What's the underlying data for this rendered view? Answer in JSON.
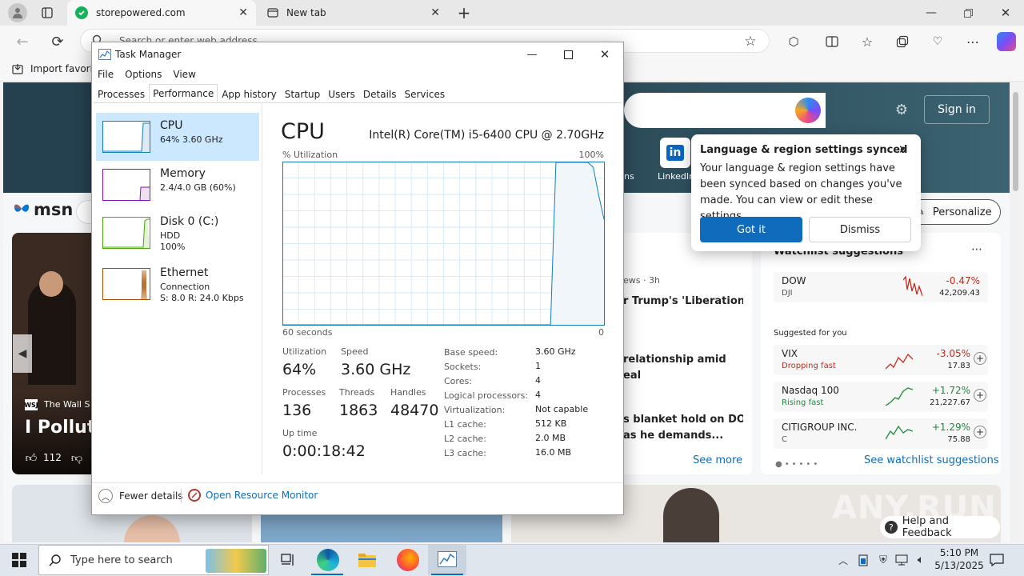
{
  "browser": {
    "tabs": [
      {
        "title": "storepowered.com",
        "active": true
      },
      {
        "title": "New tab",
        "active": false
      }
    ],
    "address_placeholder": "Search or enter web address",
    "favorites_import": "Import favorites"
  },
  "msn": {
    "logo_text": "msn",
    "sign_in": "Sign in",
    "shortcut_linkedin": "LinkedIn",
    "shortcut_partial": "ns",
    "personalize": "Personalize",
    "hero_source": "The Wall Street Journal",
    "hero_source_badge": "WSJ",
    "hero_headline": "I Pollute",
    "likes": "112",
    "news_time": "ews · 3h",
    "news1": "r Trump's 'Liberation",
    "news2a": "relationship amid",
    "news2b": "eal",
    "news3a": "s blanket hold on DOJ",
    "news3b": "as he demands...",
    "see_more": "See more",
    "watchlist_title": "Watchlist suggestions",
    "suggested_label": "Suggested for you",
    "see_watchlist": "See watchlist suggestions",
    "help_feedback": "Help and Feedback",
    "stocks": [
      {
        "name": "DOW",
        "sub": "DJI",
        "change": "-0.47%",
        "price": "42,209.43",
        "color": "#c42b1c"
      },
      {
        "name": "VIX",
        "sub": "Dropping fast",
        "change": "-3.05%",
        "price": "17.83",
        "color": "#c42b1c"
      },
      {
        "name": "Nasdaq 100",
        "sub": "Rising fast",
        "change": "+1.72%",
        "price": "21,227.67",
        "color": "#1b8a3a"
      },
      {
        "name": "CITIGROUP INC.",
        "sub": "C",
        "change": "+1.29%",
        "price": "75.88",
        "color": "#1b8a3a"
      }
    ]
  },
  "notification": {
    "title": "Language & region settings synced",
    "body": "Your language & region settings have been synced based on changes you've made. You can view or edit these settings.",
    "got_it": "Got it",
    "dismiss": "Dismiss"
  },
  "taskmanager": {
    "title": "Task Manager",
    "menu": [
      "File",
      "Options",
      "View"
    ],
    "tabs": [
      "Processes",
      "Performance",
      "App history",
      "Startup",
      "Users",
      "Details",
      "Services"
    ],
    "selected_tab": "Performance",
    "sidebar": [
      {
        "name": "CPU",
        "s1": "64%  3.60 GHz",
        "s2": "",
        "color": "#117dbb"
      },
      {
        "name": "Memory",
        "s1": "2.4/4.0 GB (60%)",
        "s2": "",
        "color": "#8b12ae"
      },
      {
        "name": "Disk 0 (C:)",
        "s1": "HDD",
        "s2": "100%",
        "color": "#4da60c"
      },
      {
        "name": "Ethernet",
        "s1": "Connection",
        "s2": "S: 8.0  R: 24.0 Kbps",
        "color": "#a74f01"
      }
    ],
    "cpu": {
      "heading": "CPU",
      "model": "Intel(R) Core(TM) i5-6400 CPU @ 2.70GHz",
      "graph_label": "% Utilization",
      "graph_max": "100%",
      "graph_time": "60 seconds",
      "graph_min": "0",
      "utilization_label": "Utilization",
      "utilization": "64%",
      "speed_label": "Speed",
      "speed": "3.60 GHz",
      "processes_label": "Processes",
      "processes": "136",
      "threads_label": "Threads",
      "threads": "1863",
      "handles_label": "Handles",
      "handles": "48470",
      "uptime_label": "Up time",
      "uptime": "0:00:18:42",
      "specs": [
        {
          "k": "Base speed:",
          "v": "3.60 GHz"
        },
        {
          "k": "Sockets:",
          "v": "1"
        },
        {
          "k": "Cores:",
          "v": "4"
        },
        {
          "k": "Logical processors:",
          "v": "4"
        },
        {
          "k": "Virtualization:",
          "v": "Not capable"
        },
        {
          "k": "L1 cache:",
          "v": "512 KB"
        },
        {
          "k": "L2 cache:",
          "v": "2.0 MB"
        },
        {
          "k": "L3 cache:",
          "v": "16.0 MB"
        }
      ],
      "history": [
        0,
        0,
        0,
        0,
        0,
        0,
        0,
        0,
        0,
        0,
        0,
        0,
        0,
        0,
        0,
        0,
        0,
        0,
        0,
        0,
        0,
        0,
        0,
        0,
        0,
        0,
        0,
        0,
        0,
        0,
        0,
        0,
        0,
        0,
        0,
        0,
        0,
        0,
        0,
        0,
        0,
        0,
        0,
        0,
        0,
        0,
        0,
        0,
        0,
        0,
        0,
        100,
        100,
        100,
        100,
        100,
        100,
        100,
        97,
        80,
        65
      ]
    },
    "fewer_details": "Fewer details",
    "open_resource_monitor": "Open Resource Monitor"
  },
  "taskbar": {
    "search_placeholder": "Type here to search",
    "time": "5:10 PM",
    "date": "5/13/2025"
  },
  "watermark": "ANY.RUN",
  "colors": {
    "accent": "#0f6cbd",
    "cpu": "#117dbb"
  }
}
